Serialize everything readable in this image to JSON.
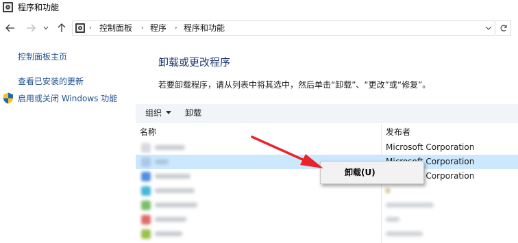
{
  "window": {
    "title": "程序和功能"
  },
  "nav": {
    "back": "back-arrow",
    "forward": "forward-arrow",
    "recent": "chevron-down",
    "up": "up-arrow"
  },
  "address": {
    "crumbs": [
      "控制面板",
      "程序",
      "程序和功能"
    ],
    "separator": "›",
    "refresh_icon": "refresh-icon"
  },
  "sidebar": {
    "items": [
      {
        "label": "控制面板主页"
      },
      {
        "label": "查看已安装的更新"
      },
      {
        "label": "启用或关闭 Windows 功能"
      }
    ]
  },
  "main": {
    "title": "卸载或更改程序",
    "description": "若要卸载程序，请从列表中将其选中，然后单击“卸载”、“更改”或“修复”。"
  },
  "toolbar": {
    "organize_label": "组织",
    "uninstall_label": "卸载"
  },
  "table": {
    "columns": [
      "名称",
      "发布者"
    ],
    "rows": [
      {
        "name": "",
        "publisher": "Microsoft Corporation"
      },
      {
        "name": "",
        "publisher": "Microsoft Corporation"
      },
      {
        "name": "",
        "publisher": "Microsoft Corporation"
      }
    ]
  },
  "context_menu": {
    "items": [
      {
        "label": "卸载(U)"
      }
    ]
  },
  "colors": {
    "link": "#1d4f91",
    "title": "#1e3a6e",
    "selection": "#cce8ff",
    "arrow": "#e8242a"
  }
}
